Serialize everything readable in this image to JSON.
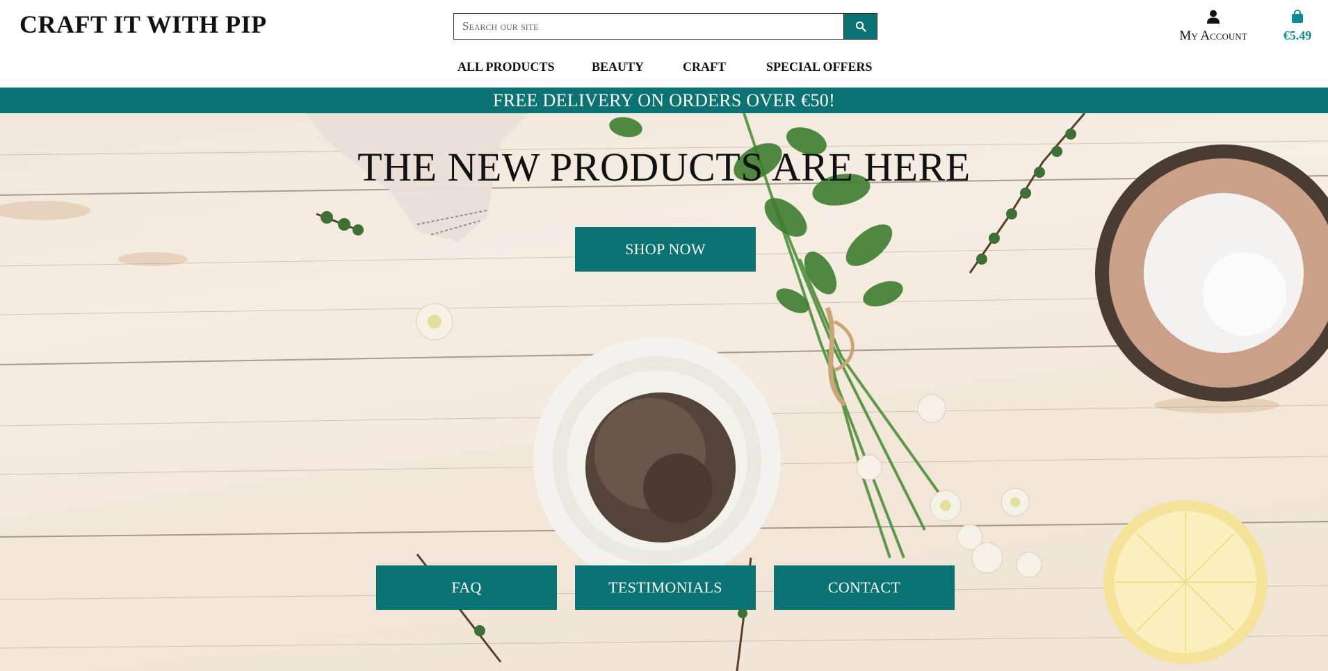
{
  "header": {
    "brand": "CRAFT IT WITH PIP",
    "search": {
      "placeholder": "Search our site"
    },
    "account_label": "My Account",
    "bag_total": "€5.49"
  },
  "nav": [
    {
      "label": "ALL PRODUCTS"
    },
    {
      "label": "BEAUTY"
    },
    {
      "label": "CRAFT"
    },
    {
      "label": "SPECIAL OFFERS"
    }
  ],
  "banner": {
    "text": "FREE DELIVERY ON ORDERS OVER €50!"
  },
  "hero": {
    "title": "THE NEW PRODUCTS ARE HERE",
    "shop_button": "SHOP NOW",
    "buttons": [
      {
        "label": "FAQ"
      },
      {
        "label": "TESTIMONIALS"
      },
      {
        "label": "CONTACT"
      }
    ]
  },
  "colors": {
    "accent": "#0b7373",
    "bag": "#0b8a9a",
    "text": "#111111"
  },
  "icons": {
    "search": "search-icon",
    "account": "user-icon",
    "bag": "shopping-bag-icon"
  }
}
